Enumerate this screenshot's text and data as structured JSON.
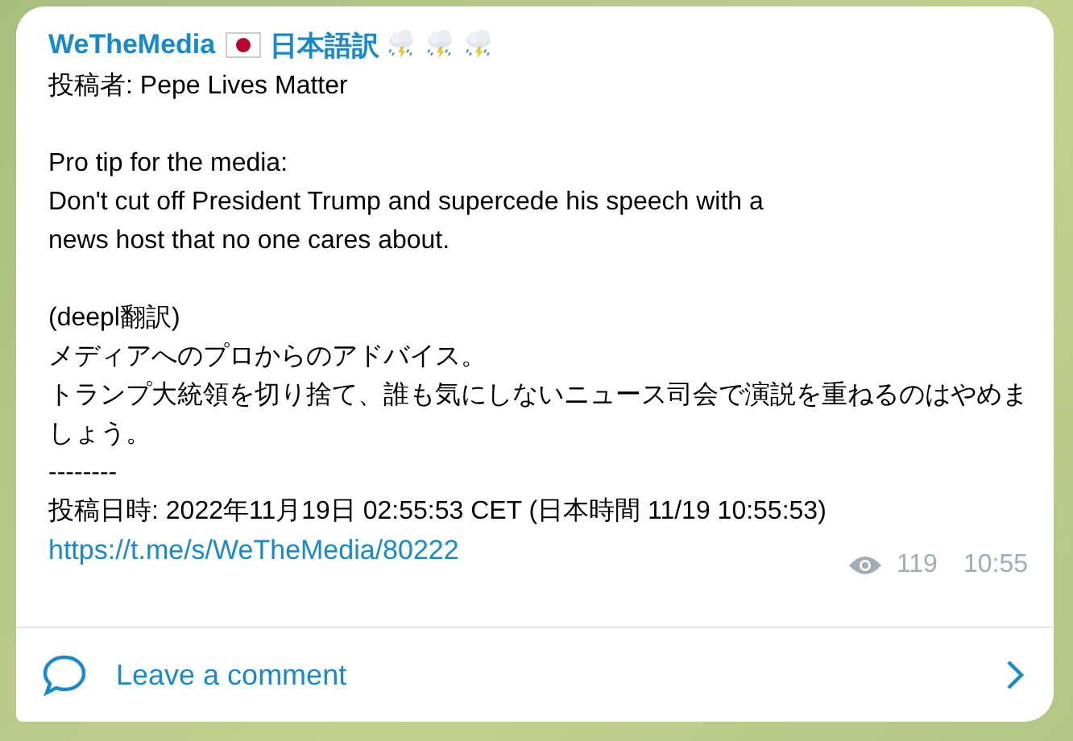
{
  "post": {
    "channel_name": "WeTheMedia",
    "channel_suffix": "日本語訳",
    "blocks": [
      {
        "lines": [
          "投稿者: Pepe Lives Matter"
        ]
      },
      {
        "lines": [
          "Pro tip for the media:",
          "Don't cut off President Trump and supercede his speech with a",
          "news host that no one cares about."
        ]
      },
      {
        "lines": [
          "(deepl翻訳)",
          "メディアへのプロからのアドバイス。",
          "トランプ大統領を切り捨て、誰も気にしないニュース司会で演説を重ねるのはやめま",
          "しょう。",
          "--------",
          "投稿日時: 2022年11月19日 02:55:53 CET (日本時間 11/19 10:55:53)"
        ]
      }
    ],
    "link": "https://t.me/s/WeTheMedia/80222",
    "views": "119",
    "time": "10:55"
  },
  "comment_bar": {
    "label": "Leave a comment"
  }
}
